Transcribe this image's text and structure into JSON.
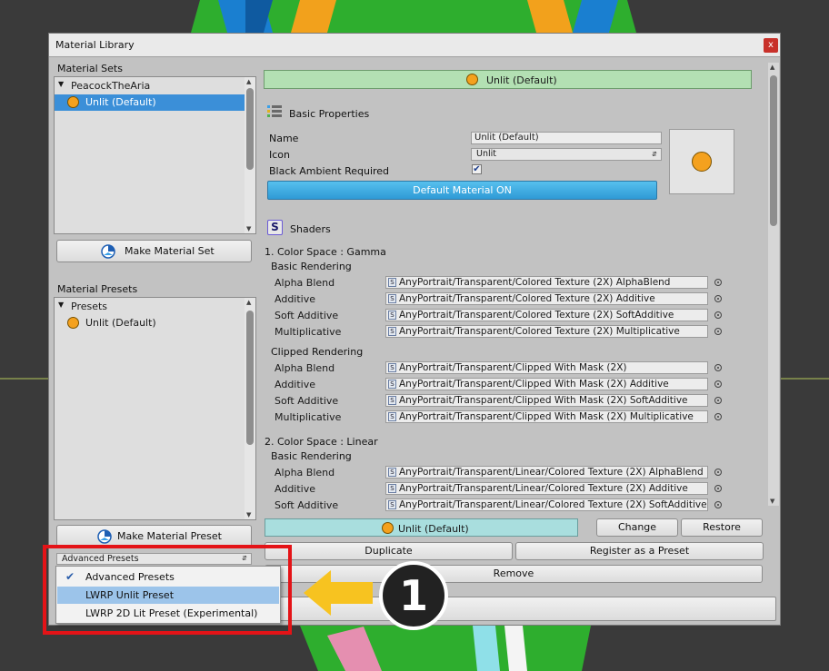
{
  "window": {
    "title": "Material Library",
    "close_glyph": "x"
  },
  "left": {
    "material_sets_label": "Material Sets",
    "sets_tree": {
      "root": "PeacockTheAria",
      "selected_item": "Unlit (Default)"
    },
    "make_set_button": "Make Material Set",
    "material_presets_label": "Material Presets",
    "presets_tree": {
      "root": "Presets",
      "item": "Unlit (Default)"
    },
    "make_preset_button": "Make Material Preset",
    "preset_dropdown": {
      "selected": "Advanced Presets"
    }
  },
  "header_bar": {
    "label": "Unlit (Default)",
    "color": "#b3e0b3"
  },
  "basic": {
    "title": "Basic Properties",
    "name_label": "Name",
    "name_value": "Unlit (Default)",
    "icon_label": "Icon",
    "icon_value": "Unlit",
    "black_ambient_label": "Black Ambient Required",
    "black_ambient_checked": true,
    "default_button": "Default Material ON",
    "accent": "#3aa8e0"
  },
  "shaders": {
    "title": "Shaders",
    "gamma_title": "1. Color Space : Gamma",
    "gamma_basic": {
      "title": "Basic Rendering",
      "rows": [
        {
          "label": "Alpha Blend",
          "value": "AnyPortrait/Transparent/Colored Texture (2X) AlphaBlend"
        },
        {
          "label": "Additive",
          "value": "AnyPortrait/Transparent/Colored Texture (2X) Additive"
        },
        {
          "label": "Soft Additive",
          "value": "AnyPortrait/Transparent/Colored Texture (2X) SoftAdditive"
        },
        {
          "label": "Multiplicative",
          "value": "AnyPortrait/Transparent/Colored Texture (2X) Multiplicative"
        }
      ]
    },
    "gamma_clipped": {
      "title": "Clipped Rendering",
      "rows": [
        {
          "label": "Alpha Blend",
          "value": "AnyPortrait/Transparent/Clipped With Mask (2X)"
        },
        {
          "label": "Additive",
          "value": "AnyPortrait/Transparent/Clipped With Mask (2X) Additive"
        },
        {
          "label": "Soft Additive",
          "value": "AnyPortrait/Transparent/Clipped With Mask (2X) SoftAdditive"
        },
        {
          "label": "Multiplicative",
          "value": "AnyPortrait/Transparent/Clipped With Mask (2X) Multiplicative"
        }
      ]
    },
    "linear_title": "2. Color Space : Linear",
    "linear_basic": {
      "title": "Basic Rendering",
      "rows": [
        {
          "label": "Alpha Blend",
          "value": "AnyPortrait/Transparent/Linear/Colored Texture (2X) AlphaBlend"
        },
        {
          "label": "Additive",
          "value": "AnyPortrait/Transparent/Linear/Colored Texture (2X) Additive"
        },
        {
          "label": "Soft Additive",
          "value": "AnyPortrait/Transparent/Linear/Colored Texture (2X) SoftAdditive"
        }
      ]
    }
  },
  "bottom": {
    "current_label": "Unlit (Default)",
    "current_color": "#a9dede",
    "change_button": "Change",
    "restore_button": "Restore",
    "duplicate_button": "Duplicate",
    "register_button": "Register as a Preset",
    "remove_button": "Remove"
  },
  "dropdown_menu": {
    "items": [
      "Advanced Presets",
      "LWRP Unlit Preset",
      "LWRP 2D Lit Preset (Experimental)"
    ],
    "checked_index": 0,
    "highlighted_index": 1
  },
  "annotation": {
    "number": "1",
    "arrow_color": "#f7c320",
    "box_color": "#e41317"
  }
}
